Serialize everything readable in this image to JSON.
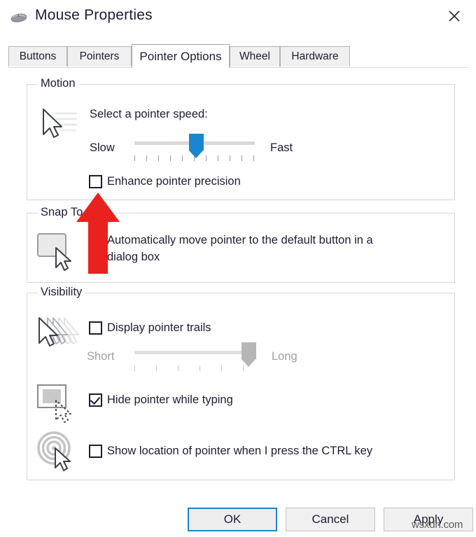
{
  "window": {
    "title": "Mouse Properties",
    "icon": "mouse-icon",
    "close_label": "✕"
  },
  "tabs": [
    {
      "label": "Buttons",
      "active": false
    },
    {
      "label": "Pointers",
      "active": false
    },
    {
      "label": "Pointer Options",
      "active": true
    },
    {
      "label": "Wheel",
      "active": false
    },
    {
      "label": "Hardware",
      "active": false
    }
  ],
  "motion": {
    "group_label": "Motion",
    "speed_label": "Select a pointer speed:",
    "slow_label": "Slow",
    "fast_label": "Fast",
    "slider": {
      "value": 50,
      "min_label": "Slow",
      "max_label": "Fast",
      "ticks": 11,
      "thumb_color": "#1a86d0",
      "enabled": true
    },
    "enhance_precision": {
      "label": "Enhance pointer precision",
      "checked": false
    },
    "icon": "pointer-speed-icon"
  },
  "snap_to": {
    "group_label": "Snap To",
    "auto_move_line1": "Automatically move pointer to the default button in a",
    "auto_move_line2": "dialog box",
    "checked": false,
    "icon": "snap-to-button-icon"
  },
  "visibility": {
    "group_label": "Visibility",
    "pointer_trails": {
      "label": "Display pointer trails",
      "checked": false,
      "icon": "pointer-trails-icon",
      "short_label": "Short",
      "long_label": "Long",
      "slider": {
        "value": 90,
        "ticks": 6,
        "thumb_color": "#b6b6b6",
        "enabled": false
      }
    },
    "hide_while_typing": {
      "label": "Hide pointer while typing",
      "checked": true,
      "icon": "hide-pointer-typing-icon"
    },
    "show_location": {
      "label": "Show location of pointer when I press the CTRL key",
      "checked": false,
      "icon": "show-location-radar-icon"
    }
  },
  "footer": {
    "ok_label": "OK",
    "cancel_label": "Cancel",
    "apply_label": "Apply"
  },
  "annotation": {
    "type": "red-up-arrow",
    "color": "#e8221e",
    "points_to": "Enhance pointer precision"
  },
  "watermark": {
    "text": "wsxdn.com"
  }
}
